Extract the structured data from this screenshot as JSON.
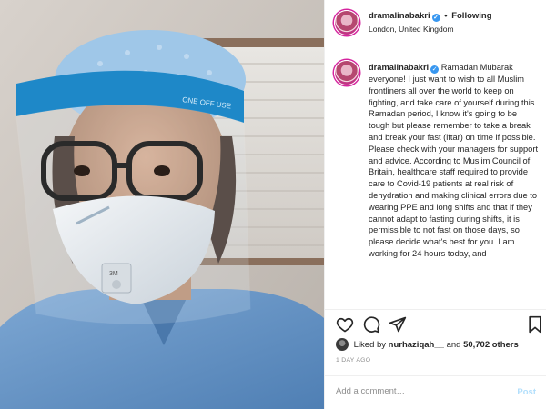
{
  "post": {
    "username": "dramalinabakri",
    "verified_glyph": "✓",
    "separator": "•",
    "follow_label": "Following",
    "location": "London, United Kingdom",
    "caption": "Ramadan Mubarak everyone! I just want to wish to all Muslim frontliners all over the world to keep on fighting, and take care of yourself during this Ramadan period, I know it's going to be tough but please remember to take a break and break your fast (iftar) on time if possible. Please check with your managers for support and advice. According to Muslim Council of Britain, healthcare staff required to provide care to Covid-19 patients at real risk of dehydration and making clinical errors due to wearing PPE and long shifts and that if they cannot adapt to fasting during shifts, it is permissible to not fast on those days, so please decide what's best for you. I am working for 24 hours today, and I",
    "likes": {
      "prefix": "Liked by",
      "user": "nurhaziqah__",
      "conjunction": "and",
      "count": "50,702 others"
    },
    "time_ago": "1 DAY AGO"
  },
  "photo": {
    "face_shield_text": "ONE OFF USE",
    "mask_text": "3M"
  },
  "actions": {
    "icons": [
      "heart-icon",
      "comment-icon",
      "share-icon",
      "bookmark-icon"
    ]
  },
  "comment": {
    "placeholder": "Add a comment…",
    "post_label": "Post"
  },
  "colors": {
    "link_blue": "#3897f0",
    "post_disabled": "#b2dffc",
    "shield_band": "#1e88c8",
    "scrubs": "#6c9ac8"
  }
}
